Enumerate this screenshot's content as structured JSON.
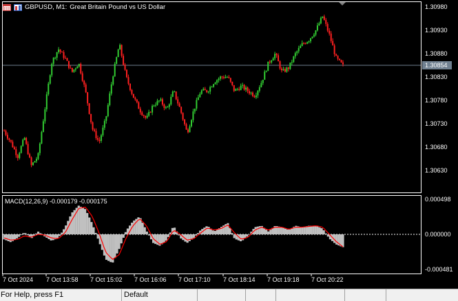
{
  "window": {
    "symbol": "GBPUSD, M1:",
    "description": "Great Britain Pound vs US Dollar"
  },
  "price_axis": {
    "labels": [
      "1.30980",
      "1.30930",
      "1.30880",
      "1.30830",
      "1.30780",
      "1.30730",
      "1.30680",
      "1.30630"
    ],
    "current_price": "1.30854"
  },
  "macd": {
    "label": "MACD(12,26,9) -0.000179 -0.000175",
    "axis_labels": [
      "0.000498",
      "0.000000",
      "-0.000481"
    ]
  },
  "time_axis": {
    "labels": [
      "7 Oct 2024",
      "7 Oct 13:58",
      "7 Oct 15:02",
      "7 Oct 16:06",
      "7 Oct 17:10",
      "7 Oct 18:14",
      "7 Oct 19:18",
      "7 Oct 20:22"
    ]
  },
  "status_bar": {
    "help": "For Help, press F1",
    "profile": "Default"
  },
  "colors": {
    "bull": "#32cd32",
    "bear": "#ff2020",
    "macd_hist": "#c0c0c0",
    "signal": "#ff0000",
    "grid": "#ffffff",
    "background": "#000000"
  },
  "chart_data": [
    {
      "type": "line",
      "title": "GBPUSD, M1",
      "ylim": [
        1.3061,
        1.3099
      ],
      "x": [
        "7 Oct 2024",
        "7 Oct 13:58",
        "7 Oct 15:02",
        "7 Oct 16:06",
        "7 Oct 17:10",
        "7 Oct 18:14",
        "7 Oct 19:18",
        "7 Oct 20:22"
      ],
      "series": [
        {
          "values": [
            1.30715,
            1.3069,
            1.3066,
            1.307,
            1.3064,
            1.3066,
            1.3076,
            1.3086,
            1.3089,
            1.3087,
            1.3084,
            1.3086,
            1.308,
            1.3072,
            1.3069,
            1.3074,
            1.3083,
            1.309,
            1.3083,
            1.3079,
            1.3076,
            1.3074,
            1.3077,
            1.3078,
            1.3076,
            1.308,
            1.3076,
            1.3071,
            1.3076,
            1.308,
            1.308,
            1.3082,
            1.3083,
            1.3083,
            1.308,
            1.3081,
            1.308,
            1.3079,
            1.3082,
            1.3086,
            1.3088,
            1.3084,
            1.3085,
            1.3088,
            1.309,
            1.3091,
            1.3093,
            1.3096,
            1.3092,
            1.3087,
            1.30854
          ]
        }
      ]
    },
    {
      "type": "area",
      "title": "MACD(12,26,9)",
      "ylim": [
        -0.000481,
        0.000498
      ],
      "series": [
        {
          "name": "MACD",
          "values": [
            -7e-05,
            -0.00011,
            -5e-05,
            3e-05,
            -6e-05,
            4e-05,
            -3e-05,
            -9e-05,
            -5e-05,
            0.0001,
            0.0003,
            0.0004,
            0.00035,
            0.00015,
            -0.0001,
            -0.00035,
            -0.0004,
            -0.0002,
            5e-05,
            0.00018,
            0.00025,
            5e-05,
            -0.00012,
            -0.00016,
            -8e-05,
            0.00012,
            -5e-05,
            -0.00012,
            -5e-05,
            6e-05,
            0.00012,
            4e-05,
            0.0001,
            0.00016,
            -6e-05,
            -0.0001,
            -2e-05,
            0.0001,
            0.00012,
            4e-05,
            0.00012,
            0.0001,
            6e-05,
            0.00012,
            0.0001,
            0.00012,
            0.00012,
            8e-05,
            -6e-05,
            -0.00014,
            -0.000179
          ]
        },
        {
          "name": "Signal",
          "values": [
            -5e-05,
            -8e-05,
            -7e-05,
            -2e-05,
            -4e-05,
            0.0,
            -1e-05,
            -5e-05,
            -6e-05,
            2e-05,
            0.0002,
            0.00036,
            0.00038,
            0.00025,
            2e-05,
            -0.00025,
            -0.00035,
            -0.00028,
            -5e-05,
            0.00012,
            0.00022,
            0.00012,
            -6e-05,
            -0.00014,
            -0.0001,
            6e-05,
            0.0,
            -8e-05,
            -6e-05,
            2e-05,
            9e-05,
            6e-05,
            8e-05,
            0.00013,
            2e-05,
            -7e-05,
            -4e-05,
            6e-05,
            0.0001,
            6e-05,
            0.0001,
            0.0001,
            7e-05,
            0.0001,
            0.0001,
            0.00011,
            0.00012,
            0.0001,
            0.0,
            -0.0001,
            -0.000175
          ]
        }
      ]
    }
  ]
}
